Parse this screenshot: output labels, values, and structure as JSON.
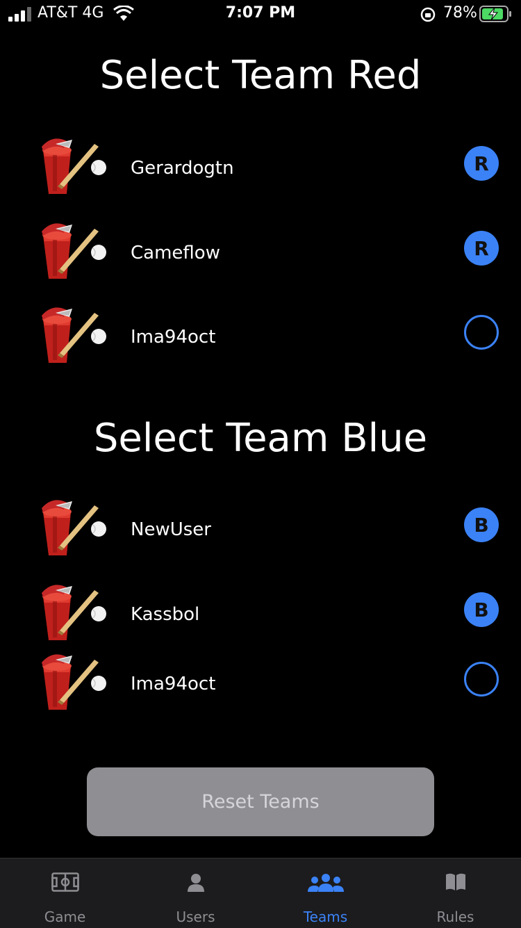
{
  "status_bar": {
    "carrier": "AT&T 4G",
    "time": "7:07 PM",
    "battery": "78%"
  },
  "team_red": {
    "title": "Select Team Red",
    "players": [
      {
        "name": "Gerardogtn",
        "badge": "R",
        "selected": true
      },
      {
        "name": "Cameflow",
        "badge": "R",
        "selected": true
      },
      {
        "name": "Ima94oct",
        "badge": "",
        "selected": false
      }
    ]
  },
  "team_blue": {
    "title": "Select Team Blue",
    "players": [
      {
        "name": "NewUser",
        "badge": "B",
        "selected": true
      },
      {
        "name": "Kassbol",
        "badge": "B",
        "selected": true
      },
      {
        "name": "Ima94oct",
        "badge": "",
        "selected": false
      }
    ]
  },
  "reset_button": "Reset Teams",
  "tabs": [
    {
      "label": "Game",
      "icon": "field-icon",
      "active": false
    },
    {
      "label": "Users",
      "icon": "person-icon",
      "active": false
    },
    {
      "label": "Teams",
      "icon": "people-icon",
      "active": true
    },
    {
      "label": "Rules",
      "icon": "book-icon",
      "active": false
    }
  ],
  "colors": {
    "accent": "#3b82f6",
    "background": "#000000",
    "button": "#8e8e93",
    "tabbar": "#1c1c1e"
  }
}
